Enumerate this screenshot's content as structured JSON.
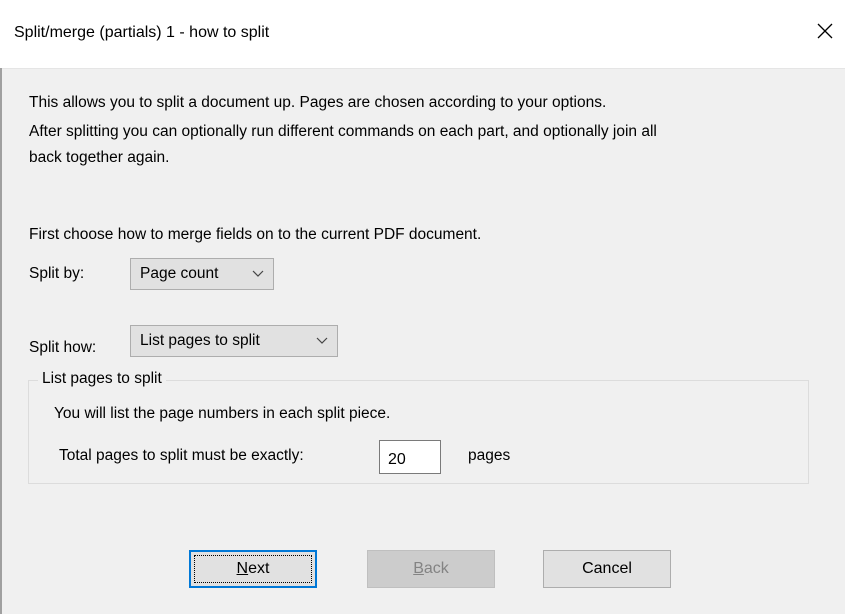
{
  "window": {
    "title": "Split/merge (partials) 1 - how to split"
  },
  "intro": {
    "line1": "This allows you to split a document up. Pages are chosen according to your options.",
    "line2a": "After splitting you can optionally run different commands on each part, and optionally join all",
    "line2b": "back together again."
  },
  "instruction": "First choose how to merge fields on to the current PDF document.",
  "split_by": {
    "label": "Split by:",
    "value": "Page count"
  },
  "split_how": {
    "label": "Split how:",
    "value": "List pages to split"
  },
  "group": {
    "label": "List pages to split",
    "description": "You will list the page numbers in each split piece.",
    "total_label": "Total pages to split must be exactly:",
    "total_value": "20",
    "unit": "pages"
  },
  "buttons": {
    "next": {
      "mnemonic": "N",
      "rest": "ext"
    },
    "back": {
      "mnemonic": "B",
      "rest": "ack"
    },
    "cancel": "Cancel"
  },
  "icons": {
    "close": "close-icon",
    "dropdown": "chevron-down-icon"
  }
}
